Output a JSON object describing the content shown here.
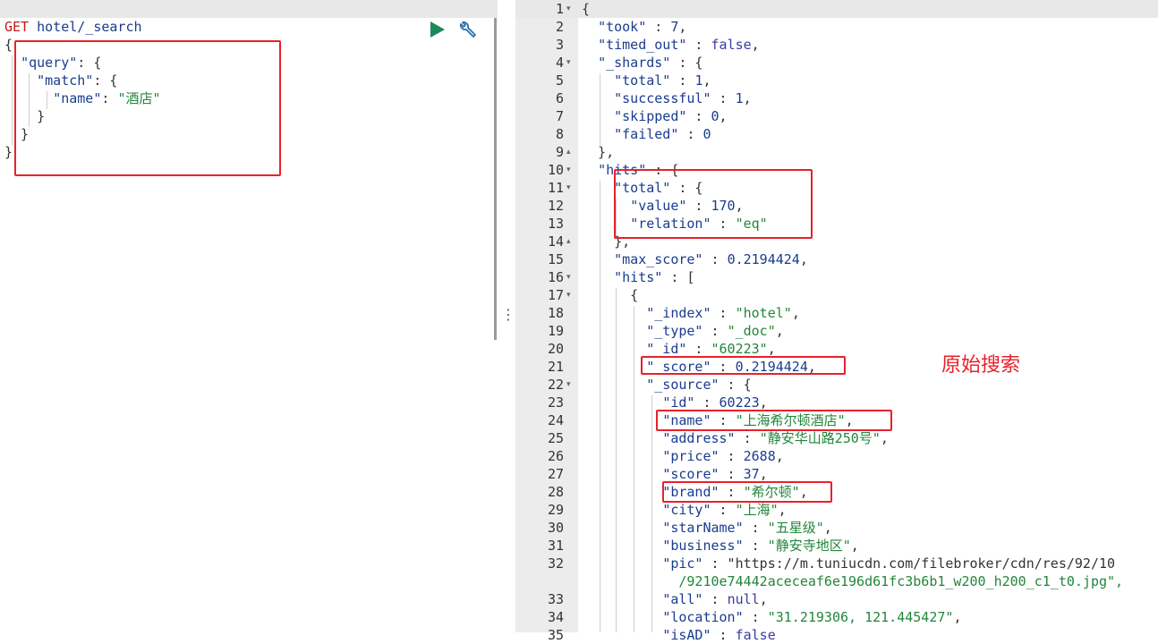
{
  "request": {
    "method": "GET",
    "path": "hotel/_search",
    "lines": [
      "{",
      "  \"query\": {",
      "    \"match\": {",
      "      \"name\": \"酒店\"",
      "    }",
      "  }",
      "}"
    ]
  },
  "toolbar": {
    "run_icon": "play-icon",
    "settings_icon": "wrench-icon"
  },
  "splitter": {
    "glyph": "⋮"
  },
  "response": {
    "line_numbers": [
      "1",
      "2",
      "3",
      "4",
      "5",
      "6",
      "7",
      "8",
      "9",
      "10",
      "11",
      "12",
      "13",
      "14",
      "15",
      "16",
      "17",
      "18",
      "19",
      "20",
      "21",
      "22",
      "23",
      "24",
      "25",
      "26",
      "27",
      "28",
      "29",
      "30",
      "31",
      "32",
      "",
      "33",
      "34",
      "35"
    ],
    "lines": [
      "{",
      "  \"took\" : 7,",
      "  \"timed_out\" : false,",
      "  \"_shards\" : {",
      "    \"total\" : 1,",
      "    \"successful\" : 1,",
      "    \"skipped\" : 0,",
      "    \"failed\" : 0",
      "  },",
      "  \"hits\" : {",
      "    \"total\" : {",
      "      \"value\" : 170,",
      "      \"relation\" : \"eq\"",
      "    },",
      "    \"max_score\" : 0.2194424,",
      "    \"hits\" : [",
      "      {",
      "        \"_index\" : \"hotel\",",
      "        \"_type\" : \"_doc\",",
      "        \"_id\" : \"60223\",",
      "        \"_score\" : 0.2194424,",
      "        \"_source\" : {",
      "          \"id\" : 60223,",
      "          \"name\" : \"上海希尔顿酒店\",",
      "          \"address\" : \"静安华山路250号\",",
      "          \"price\" : 2688,",
      "          \"score\" : 37,",
      "          \"brand\" : \"希尔顿\",",
      "          \"city\" : \"上海\",",
      "          \"starName\" : \"五星级\",",
      "          \"business\" : \"静安寺地区\",",
      "          \"pic\" : \"https://m.tuniucdn.com/filebroker/cdn/res/92/10",
      "            /9210e74442aceceaf6e196d61fc3b6b1_w200_h200_c1_t0.jpg\",",
      "          \"all\" : null,",
      "          \"location\" : \"31.219306, 121.445427\",",
      "          \"isAD\" : false"
    ]
  },
  "annotation": {
    "text": "原始搜索"
  },
  "colors": {
    "highlight": "#e8212b",
    "string": "#22863a",
    "key": "#1a3c8f"
  }
}
